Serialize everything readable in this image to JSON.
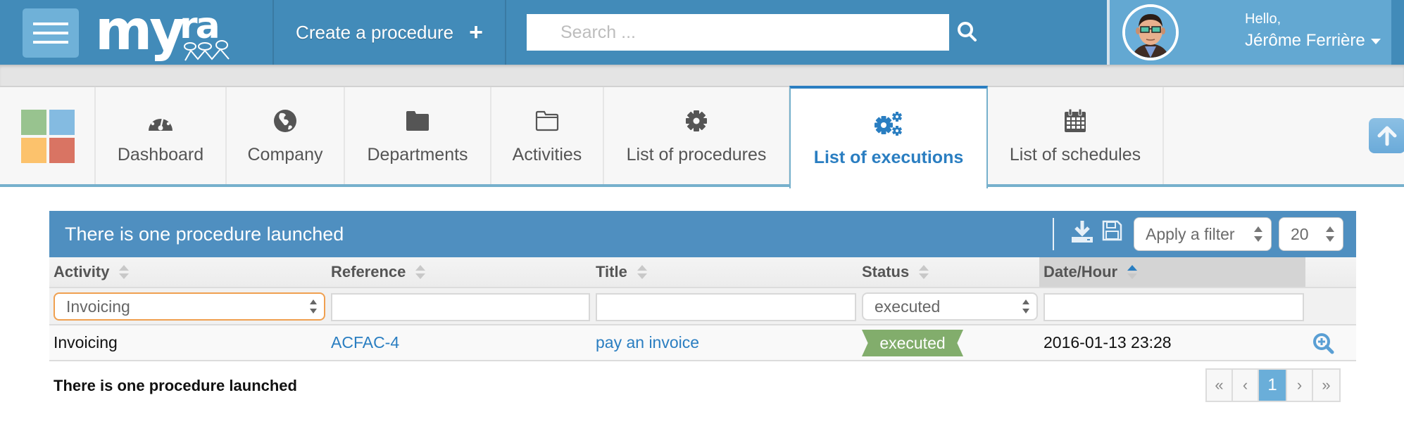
{
  "header": {
    "menu_icon": "hamburger-icon",
    "logo_text": "myra",
    "create_procedure_label": "Create a procedure",
    "create_procedure_icon": "plus-icon",
    "search_placeholder": "Search ...",
    "search_value": "",
    "search_icon": "search-icon",
    "user": {
      "greeting": "Hello,",
      "name": "Jérôme Ferrière",
      "dropdown_icon": "caret-down-icon"
    }
  },
  "nav": {
    "apps_icon": "apps-grid-icon",
    "apps_colors": [
      "#98c38f",
      "#84bbe1",
      "#fcc26c",
      "#d97463"
    ],
    "items": [
      {
        "label": "Dashboard",
        "icon": "dashboard-icon",
        "active": false
      },
      {
        "label": "Company",
        "icon": "globe-icon",
        "active": false
      },
      {
        "label": "Departments",
        "icon": "folder-icon",
        "active": false
      },
      {
        "label": "Activities",
        "icon": "folder-open-icon",
        "active": false
      },
      {
        "label": "List of procedures",
        "icon": "gear-icon",
        "active": false
      },
      {
        "label": "List of executions",
        "icon": "gears-icon",
        "active": true
      },
      {
        "label": "List of schedules",
        "icon": "calendar-icon",
        "active": false
      }
    ],
    "scroll_up_icon": "arrow-up-icon"
  },
  "panel": {
    "title": "There is one procedure launched",
    "export_icon": "download-icon",
    "save_icon": "save-icon",
    "filter_select": {
      "value": "Apply a filter"
    },
    "page_size_select": {
      "value": "20"
    },
    "columns": [
      {
        "label": "Activity",
        "sort": "none"
      },
      {
        "label": "Reference",
        "sort": "none"
      },
      {
        "label": "Title",
        "sort": "none"
      },
      {
        "label": "Status",
        "sort": "none"
      },
      {
        "label": "Date/Hour",
        "sort": "asc"
      }
    ],
    "filters": {
      "activity": "Invoicing",
      "reference": "",
      "title": "",
      "status": "executed",
      "date": ""
    },
    "rows": [
      {
        "activity": "Invoicing",
        "reference": "ACFAC-4",
        "title": "pay an invoice",
        "status": "executed",
        "date": "2016-01-13 23:28",
        "action_icon": "zoom-in-icon"
      }
    ],
    "footer_text": "There is one procedure launched",
    "pagination": {
      "first": "«",
      "prev": "‹",
      "current": "1",
      "next": "›",
      "last": "»"
    }
  },
  "colors": {
    "header_bg": "#428bb9",
    "user_panel_bg": "#63a8d2",
    "panel_header_bg": "#4f8fc0",
    "accent": "#2a7ec1",
    "status_executed": "#82ad6c",
    "active_page": "#6aaed9"
  }
}
